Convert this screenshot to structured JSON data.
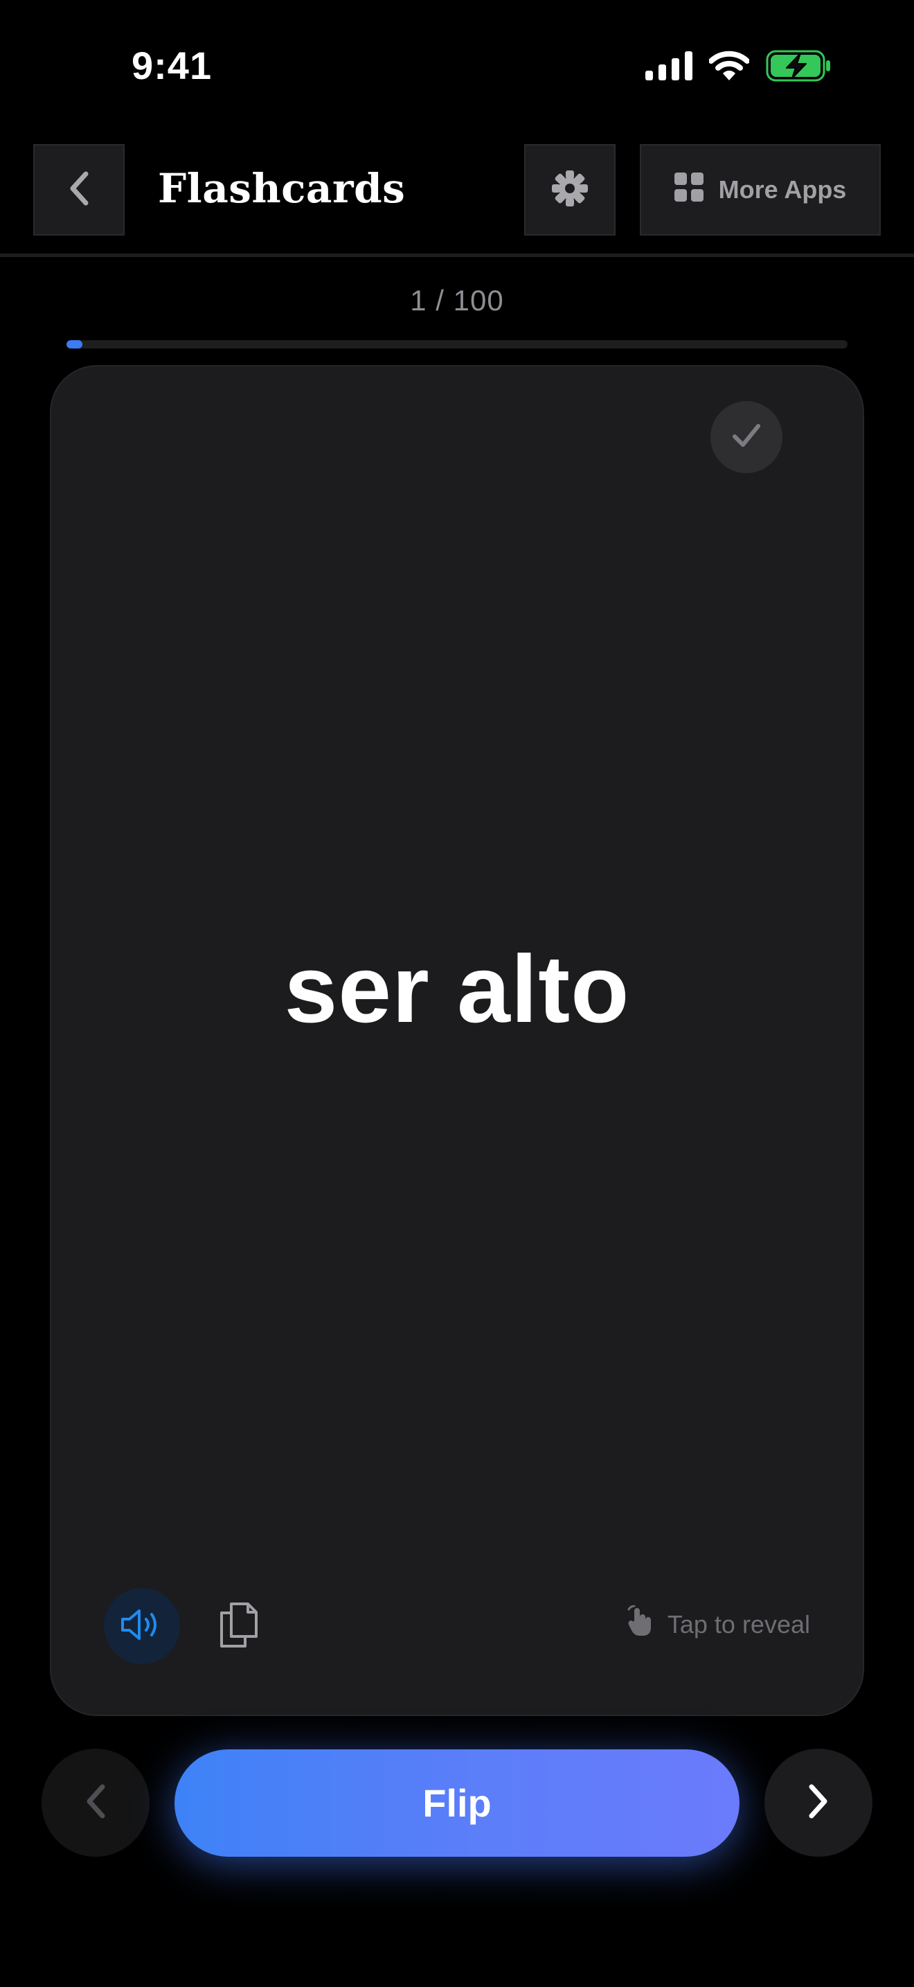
{
  "status_bar": {
    "time": "9:41",
    "icons": [
      "cellular-signal-icon",
      "wifi-icon",
      "battery-charging-icon"
    ]
  },
  "header": {
    "title": "Flashcards",
    "back_icon": "chevron-left-icon",
    "settings_icon": "gear-icon",
    "more_apps_label": "More Apps",
    "more_apps_icon": "grid-icon"
  },
  "progress": {
    "label": "1 / 100",
    "current": 1,
    "total": 100,
    "fraction": 0.01
  },
  "card": {
    "term": "ser alto",
    "mark_known_icon": "checkmark-icon",
    "speak_icon": "speaker-icon",
    "copy_icon": "copy-icon",
    "tap_hint": "Tap to reveal",
    "tap_hint_icon": "tap-hand-icon"
  },
  "controls": {
    "prev_icon": "chevron-left-icon",
    "flip_label": "Flip",
    "next_icon": "chevron-right-icon"
  },
  "colors": {
    "background": "#000000",
    "card": "#1c1c1e",
    "accent": "#3d7bf5",
    "flip_gradient_start": "#3e82f7",
    "flip_gradient_end": "#6b7bfb",
    "battery_fill": "#34c759"
  }
}
